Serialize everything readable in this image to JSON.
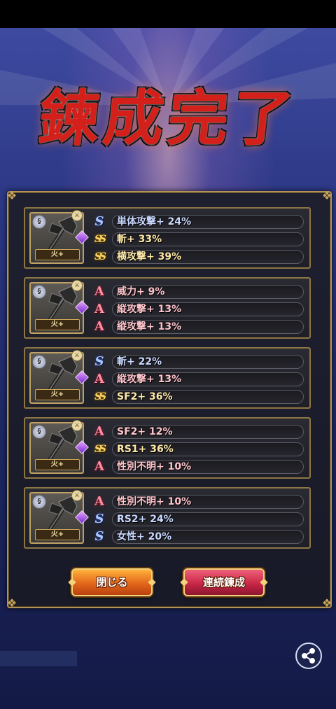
{
  "title": "鍊成完了",
  "cards": [
    {
      "element": "火+",
      "rows": [
        {
          "rank": "S",
          "rank_label": "S",
          "text": "単体攻撃+ 24%"
        },
        {
          "rank": "SS",
          "rank_label": "SS",
          "text": "斬+ 33%"
        },
        {
          "rank": "SS",
          "rank_label": "SS",
          "text": "横攻撃+ 39%"
        }
      ]
    },
    {
      "element": "火+",
      "rows": [
        {
          "rank": "A",
          "rank_label": "A",
          "text": "威力+ 9%"
        },
        {
          "rank": "A",
          "rank_label": "A",
          "text": "縦攻撃+ 13%"
        },
        {
          "rank": "A",
          "rank_label": "A",
          "text": "縦攻撃+ 13%"
        }
      ]
    },
    {
      "element": "火+",
      "rows": [
        {
          "rank": "S",
          "rank_label": "S",
          "text": "斬+ 22%"
        },
        {
          "rank": "A",
          "rank_label": "A",
          "text": "縦攻撃+ 13%"
        },
        {
          "rank": "SS",
          "rank_label": "SS",
          "text": "SF2+ 36%"
        }
      ]
    },
    {
      "element": "火+",
      "rows": [
        {
          "rank": "A",
          "rank_label": "A",
          "text": "SF2+ 12%"
        },
        {
          "rank": "SS",
          "rank_label": "SS",
          "text": "RS1+ 36%"
        },
        {
          "rank": "A",
          "rank_label": "A",
          "text": "性別不明+ 10%"
        }
      ]
    },
    {
      "element": "火+",
      "rows": [
        {
          "rank": "A",
          "rank_label": "A",
          "text": "性別不明+ 10%"
        },
        {
          "rank": "S",
          "rank_label": "S",
          "text": "RS2+ 24%"
        },
        {
          "rank": "S",
          "rank_label": "S",
          "text": "女性+ 20%"
        }
      ]
    }
  ],
  "buttons": {
    "close_label": "閉じる",
    "continue_label": "連続鍊成"
  },
  "icons": {
    "share": "share-icon",
    "weapon": "axe-weapon-icon"
  }
}
